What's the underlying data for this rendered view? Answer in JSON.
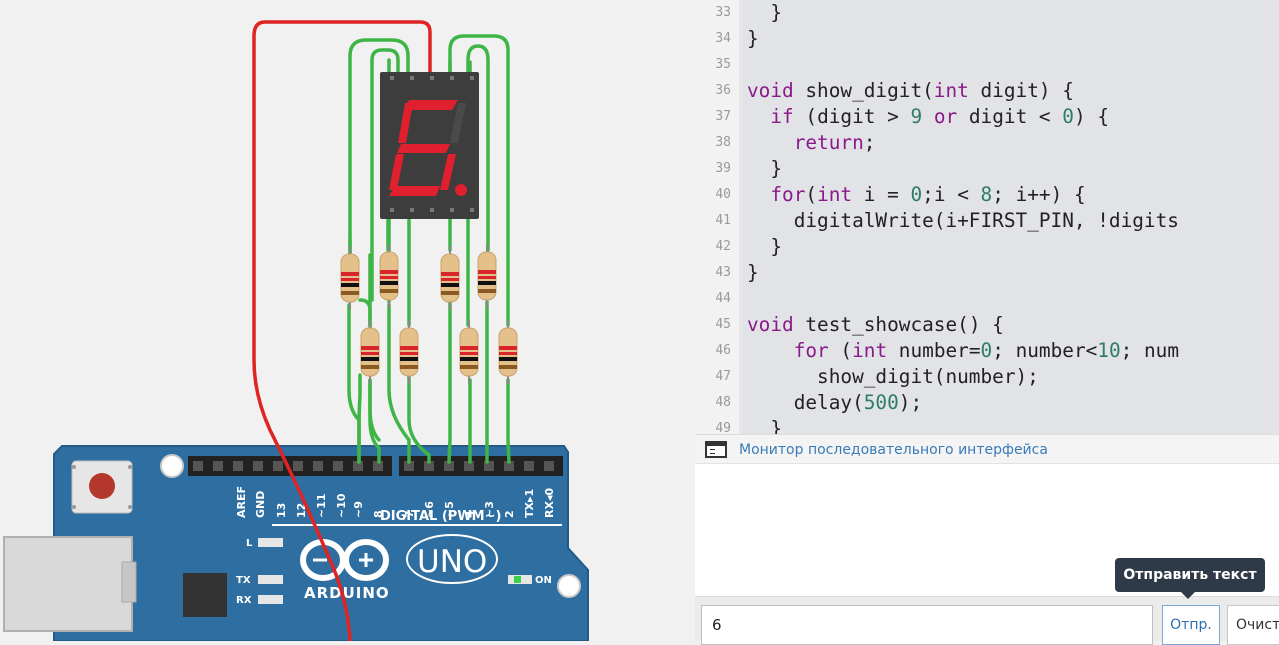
{
  "code_editor": {
    "lines": [
      {
        "num": "33",
        "html": "  }"
      },
      {
        "num": "34",
        "html": "}"
      },
      {
        "num": "35",
        "html": ""
      },
      {
        "num": "36",
        "html": "<span class=\"kw\">void</span> show_digit(<span class=\"kw\">int</span> digit) {"
      },
      {
        "num": "37",
        "html": "  <span class=\"kw\">if</span> (digit &gt; <span class=\"num\">9</span> <span class=\"kw\">or</span> digit &lt; <span class=\"num\">0</span>) {"
      },
      {
        "num": "38",
        "html": "    <span class=\"kw\">return</span>;"
      },
      {
        "num": "39",
        "html": "  }"
      },
      {
        "num": "40",
        "html": "  <span class=\"kw\">for</span>(<span class=\"kw\">int</span> i = <span class=\"num\">0</span>;i &lt; <span class=\"num\">8</span>; i++) {"
      },
      {
        "num": "41",
        "html": "    digitalWrite(i+FIRST_PIN, !digits"
      },
      {
        "num": "42",
        "html": "  }"
      },
      {
        "num": "43",
        "html": "}"
      },
      {
        "num": "44",
        "html": ""
      },
      {
        "num": "45",
        "html": "<span class=\"kw\">void</span> test_showcase() {"
      },
      {
        "num": "46",
        "html": "    <span class=\"kw\">for</span> (<span class=\"kw\">int</span> number=<span class=\"num\">0</span>; number&lt;<span class=\"num\">10</span>; num"
      },
      {
        "num": "47",
        "html": "      show_digit(number);"
      },
      {
        "num": "48",
        "html": "    delay(<span class=\"num\">500</span>);"
      },
      {
        "num": "49",
        "html": "  }"
      }
    ]
  },
  "serial_monitor": {
    "title": "Монитор последовательного интерфейса",
    "input_value": "6",
    "send_label": "Отпр.",
    "clear_label": "Очист",
    "tooltip": "Отправить текст"
  },
  "arduino": {
    "brand": "ARDUINO",
    "model": "UNO",
    "digital_label": "DIGITAL (PWM~)",
    "pin_labels": [
      "AREF",
      "GND",
      "13",
      "12",
      "~11",
      "~10",
      "~9",
      "8",
      "7",
      "~6",
      "~5",
      "4",
      "~3",
      "2",
      "TX▸1",
      "RX◂0"
    ],
    "led_labels": [
      "L",
      "TX",
      "RX",
      "ON"
    ]
  },
  "display": {
    "digit_shown": "6",
    "segment_on_color": "#e0202e",
    "segment_off_color": "#4a4a4a"
  },
  "colors": {
    "board": "#2f6ea0",
    "wire_green": "#3fb548",
    "wire_red": "#e02424"
  }
}
